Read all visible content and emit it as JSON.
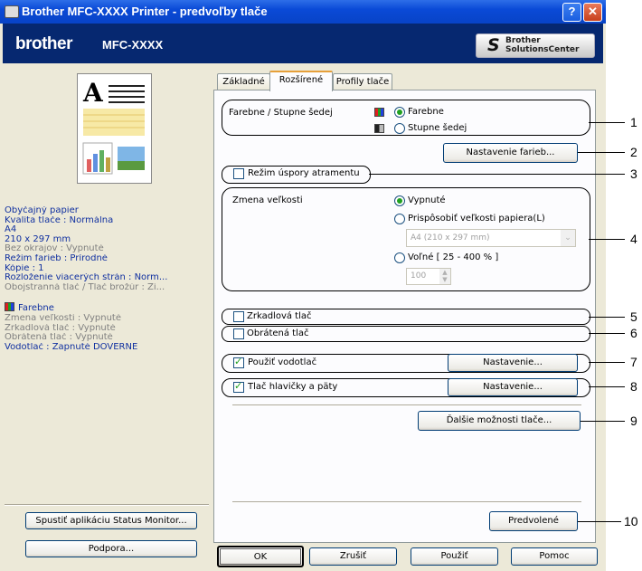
{
  "window": {
    "title": "Brother MFC-XXXX      Printer - predvoľby tlače",
    "help_label": "?",
    "close_label": "✕"
  },
  "brandbar": {
    "brand": "brother",
    "model": "MFC-XXXX",
    "solutions_center_line1": "Brother",
    "solutions_center_line2": "SolutionsCenter"
  },
  "left_pane": {
    "info": [
      {
        "text": "Obyčajný papier",
        "style": "blue"
      },
      {
        "text": "Kvalita tlače : Normálna",
        "style": "blue"
      },
      {
        "text": "A4",
        "style": "blue"
      },
      {
        "text": "210 x 297 mm",
        "style": "blue"
      },
      {
        "text": "Bez okrajov : Vypnuté",
        "style": "grey"
      },
      {
        "text": "Režim farieb : Prírodné",
        "style": "blue"
      },
      {
        "text": "Kópie : 1",
        "style": "blue"
      },
      {
        "text": "Rozloženie viacerých strán : Norm...",
        "style": "blue"
      },
      {
        "text": "Obojstranná tlač / Tlač brožúr : Ži...",
        "style": "grey"
      }
    ],
    "color_mode": "Farebne",
    "info2": [
      {
        "text": "Zmena veľkosti : Vypnuté",
        "style": "grey"
      },
      {
        "text": "Zrkadlová tlač : Vypnuté",
        "style": "grey"
      },
      {
        "text": "Obrátená tlač : Vypnuté",
        "style": "grey"
      },
      {
        "text": "Vodotlač : Zapnuté  DÔVERNÉ",
        "style": "blue"
      }
    ],
    "status_monitor_button": "Spustiť aplikáciu Status Monitor...",
    "support_button": "Podpora..."
  },
  "tabs": [
    {
      "label": "Základné",
      "active": false
    },
    {
      "label": "Rozšírené",
      "active": true
    },
    {
      "label": "Profily tlače",
      "active": false
    }
  ],
  "advanced": {
    "color_group_label": "Farebne / Stupne šedej",
    "color_option": "Farebne",
    "grayscale_option": "Stupne šedej",
    "color_settings_button": "Nastavenie farieb...",
    "ink_save_label": "Režim úspory atramentu",
    "ink_save_checked": false,
    "scaling_label": "Zmena veľkosti",
    "scaling_off": "Vypnuté",
    "scaling_fit": "Prispôsobiť veľkosti papiera(L)",
    "paper_size_value": "A4 (210 x 297 mm)",
    "scaling_free": "Voľné [ 25 - 400 % ]",
    "scaling_value": "100",
    "mirror_label": "Zrkadlová tlač",
    "reverse_label": "Obrátená tlač",
    "watermark_label": "Použiť vodotlač",
    "watermark_settings_button": "Nastavenie...",
    "header_footer_label": "Tlač hlavičky a päty",
    "header_footer_settings_button": "Nastavenie...",
    "more_options_button": "Ďalšie možnosti tlače...",
    "default_button": "Predvolené"
  },
  "footer_buttons": {
    "ok": "OK",
    "cancel": "Zrušiť",
    "apply": "Použiť",
    "help": "Pomoc"
  },
  "callouts": [
    "1",
    "2",
    "3",
    "4",
    "5",
    "6",
    "7",
    "8",
    "9",
    "10"
  ]
}
